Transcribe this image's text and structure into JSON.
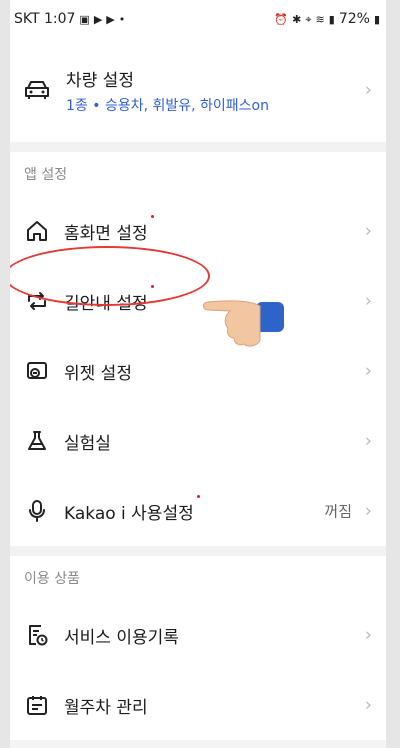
{
  "status_bar": {
    "carrier_time": "SKT 1:07",
    "battery": "72%"
  },
  "vehicle": {
    "title": "차량 설정",
    "subtitle": "1종 • 승용차, 휘발유, 하이패스on"
  },
  "app_settings": {
    "section_title": "앱 설정",
    "items": [
      {
        "label": "홈화면 설정",
        "icon": "home-icon"
      },
      {
        "label": "길안내 설정",
        "icon": "route-icon"
      },
      {
        "label": "위젯 설정",
        "icon": "widget-icon"
      },
      {
        "label": "실험실",
        "icon": "flask-icon"
      },
      {
        "label": "Kakao i 사용설정",
        "icon": "microphone-icon",
        "value": "꺼짐"
      }
    ]
  },
  "products": {
    "section_title": "이용 상품",
    "items": [
      {
        "label": "서비스 이용기록",
        "icon": "history-icon"
      },
      {
        "label": "월주차 관리",
        "icon": "calendar-icon"
      }
    ]
  },
  "colors": {
    "accent_blue": "#2f5fd6",
    "annotation_red": "#e23a35",
    "new_dot": "#e02020"
  }
}
